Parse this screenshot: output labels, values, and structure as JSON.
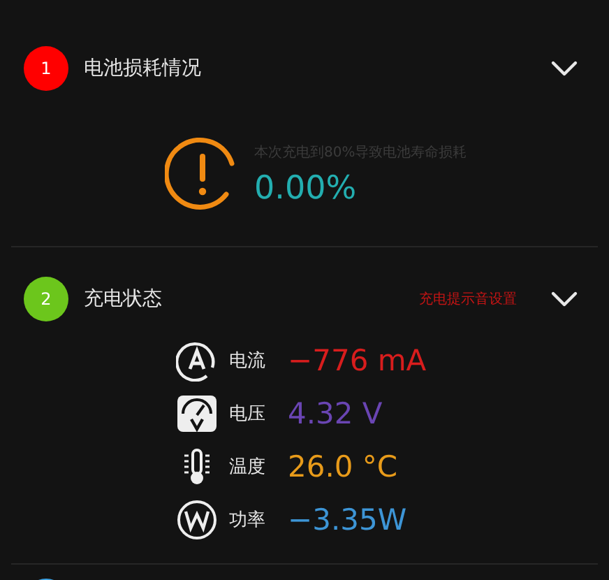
{
  "sections": [
    {
      "number": "1",
      "color": "#ff0000",
      "title": "电池损耗情况",
      "kind": "wear",
      "caption": "本次充电到80%导致电池寿命损耗",
      "value": "0.00%"
    },
    {
      "number": "2",
      "color": "#6cc61c",
      "title": "充电状态",
      "kind": "status",
      "link": "充电提示音设置",
      "metrics": [
        {
          "kind": "current",
          "label": "电流",
          "value": "−776 mA",
          "color": "#d81d1d"
        },
        {
          "kind": "voltage",
          "label": "电压",
          "value": "4.32 V",
          "color": "#6a45b3"
        },
        {
          "kind": "temperature",
          "label": "温度",
          "value": "26.0 °C",
          "color": "#e89b1a"
        },
        {
          "kind": "power",
          "label": "功率",
          "value": "−3.35W",
          "color": "#3d95d6"
        }
      ]
    },
    {
      "color": "#3ba3e6",
      "kind": "partial"
    }
  ]
}
